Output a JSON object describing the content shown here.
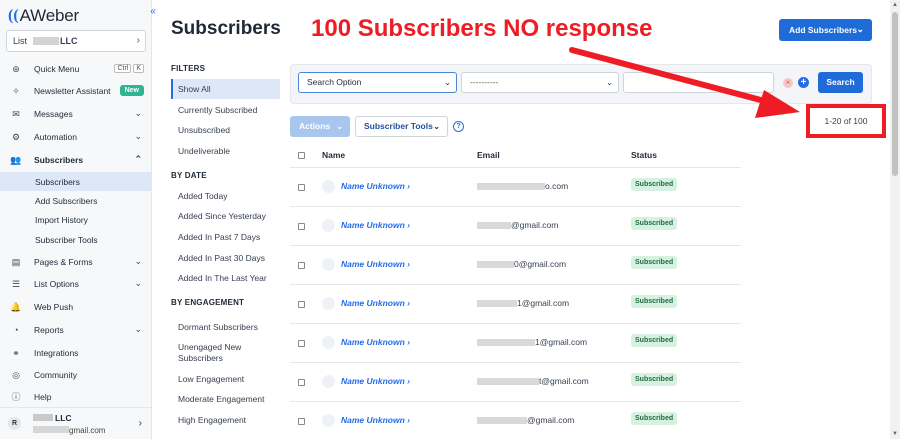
{
  "sidebar": {
    "logo_text": "AWeber",
    "collapse_glyph": "«",
    "list_label": "List",
    "list_value": "LLC",
    "items": [
      {
        "label": "Quick Menu",
        "icon": "compass-icon",
        "shortcut": [
          "Ctrl",
          "K"
        ]
      },
      {
        "label": "Newsletter Assistant",
        "icon": "sparkle-icon",
        "badge": "New"
      },
      {
        "label": "Messages",
        "icon": "envelope-icon"
      },
      {
        "label": "Automation",
        "icon": "automation-icon"
      },
      {
        "label": "Subscribers",
        "icon": "people-icon"
      },
      {
        "label": "Pages & Forms",
        "icon": "pages-icon"
      },
      {
        "label": "List Options",
        "icon": "list-icon"
      },
      {
        "label": "Web Push",
        "icon": "bell-icon"
      },
      {
        "label": "Reports",
        "icon": "chart-icon"
      },
      {
        "label": "Integrations",
        "icon": "plug-icon"
      },
      {
        "label": "Community",
        "icon": "community-icon"
      },
      {
        "label": "Help",
        "icon": "help-icon"
      }
    ],
    "sub_items": [
      "Subscribers",
      "Add Subscribers",
      "Import History",
      "Subscriber Tools"
    ],
    "account": {
      "initial": "R",
      "name": "LLC",
      "email": "gmail.com"
    }
  },
  "page": {
    "title": "Subscribers",
    "add_button": "Add Subscribers"
  },
  "annotation": {
    "text": "100 Subscribers NO response",
    "color": "#ee1c24"
  },
  "filters": {
    "heading": "FILTERS",
    "items": [
      "Show All",
      "Currently Subscribed",
      "Unsubscribed",
      "Undeliverable"
    ],
    "by_date_heading": "BY DATE",
    "by_date": [
      "Added Today",
      "Added Since Yesterday",
      "Added In Past 7 Days",
      "Added In Past 30 Days",
      "Added In The Last Year"
    ],
    "by_engagement_heading": "BY ENGAGEMENT",
    "by_engagement": [
      "Dormant Subscribers",
      "Unengaged New Subscribers",
      "Low Engagement",
      "Moderate Engagement",
      "High Engagement"
    ]
  },
  "search": {
    "option": "Search Option",
    "operator": "----------",
    "button": "Search"
  },
  "toolbar": {
    "actions": "Actions",
    "tools": "Subscriber Tools",
    "help": "?"
  },
  "pagination": "1-20 of 100",
  "table": {
    "columns": [
      "Name",
      "Email",
      "Status"
    ],
    "rows": [
      {
        "name": "Name Unknown",
        "email": "o.com",
        "status": "Subscribed"
      },
      {
        "name": "Name Unknown",
        "email": "@gmail.com",
        "status": "Subscribed"
      },
      {
        "name": "Name Unknown",
        "email": "0@gmail.com",
        "status": "Subscribed"
      },
      {
        "name": "Name Unknown",
        "email": "1@gmail.com",
        "status": "Subscribed"
      },
      {
        "name": "Name Unknown",
        "email": "1@gmail.com",
        "status": "Subscribed"
      },
      {
        "name": "Name Unknown",
        "email": "t@gmail.com",
        "status": "Subscribed"
      },
      {
        "name": "Name Unknown",
        "email": "@gmail.com",
        "status": "Subscribed"
      }
    ]
  }
}
